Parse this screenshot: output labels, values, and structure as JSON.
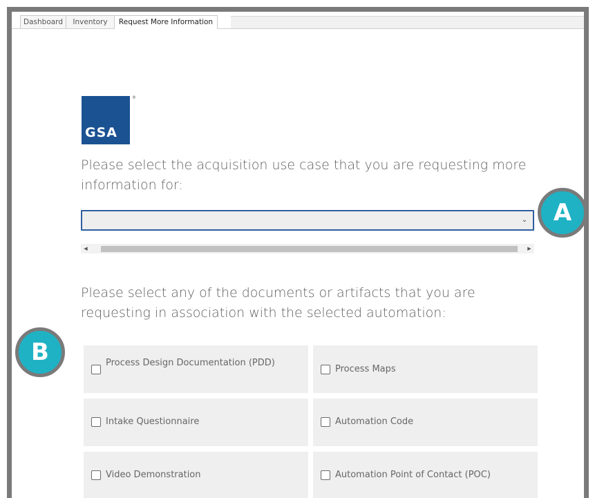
{
  "tabs": [
    {
      "label": "Dashboard",
      "active": false
    },
    {
      "label": "Inventory",
      "active": false
    },
    {
      "label": "Request More Information",
      "active": true
    }
  ],
  "logo": {
    "text": "GSA",
    "reg_mark": "®",
    "color": "#1a5292"
  },
  "question1": {
    "text": "Please select the acquisition use case that you are requesting more information for:"
  },
  "use_case_select": {
    "value": "",
    "chevron": "⌄",
    "border_color": "#2d5da0"
  },
  "scrollbar": {
    "left_arrow": "◀",
    "right_arrow": "▶"
  },
  "question2": {
    "text": "Please select any of the documents or artifacts that you are requesting in association with the selected automation:"
  },
  "artifacts": [
    {
      "label": "Process Design Documentation (PDD)",
      "checked": false
    },
    {
      "label": "Process Maps",
      "checked": false
    },
    {
      "label": "Intake Questionnaire",
      "checked": false
    },
    {
      "label": "Automation Code",
      "checked": false
    },
    {
      "label": "Video Demonstration",
      "checked": false
    },
    {
      "label": "Automation Point of Contact (POC)",
      "checked": false
    }
  ],
  "callouts": {
    "a": "A",
    "b": "B",
    "color": "#1fb2c4"
  }
}
